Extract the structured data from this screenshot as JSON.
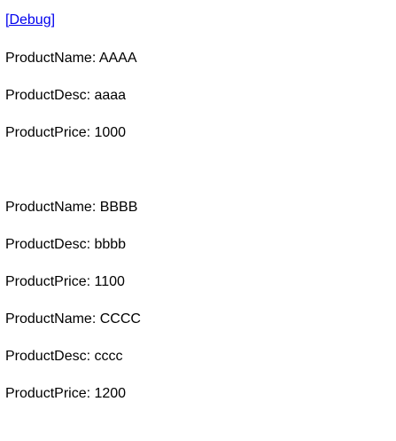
{
  "debug_link": "[Debug]",
  "products": [
    {
      "name_line": "ProductName: AAAA",
      "desc_line": "ProductDesc: aaaa",
      "price_line": "ProductPrice: 1000"
    },
    {
      "name_line": "ProductName: BBBB",
      "desc_line": "ProductDesc: bbbb",
      "price_line": "ProductPrice: 1100"
    },
    {
      "name_line": "ProductName: CCCC",
      "desc_line": "ProductDesc: cccc",
      "price_line": "ProductPrice: 1200"
    }
  ],
  "colors": {
    "link": "#0000ee",
    "text": "#000000",
    "background": "#ffffff"
  }
}
